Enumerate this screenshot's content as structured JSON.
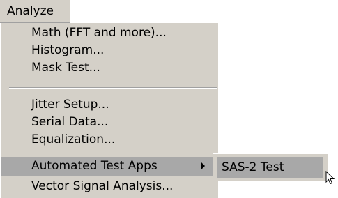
{
  "menubar": {
    "analyze_label": "Analyze"
  },
  "menu": {
    "items": [
      {
        "label": "Math (FFT and more)..."
      },
      {
        "label": "Histogram..."
      },
      {
        "label": "Mask Test..."
      },
      {
        "label": "Jitter Setup..."
      },
      {
        "label": "Serial Data..."
      },
      {
        "label": "Equalization..."
      },
      {
        "label": "Automated Test Apps"
      },
      {
        "label": "Vector Signal Analysis..."
      }
    ]
  },
  "submenu": {
    "items": [
      {
        "label": "SAS-2 Test"
      }
    ]
  },
  "icons": {
    "submenu_arrow": "chevron-right-icon",
    "pointer": "mouse-pointer-icon"
  },
  "colors": {
    "menu_background": "#d4d0c8",
    "highlight": "#a8a8a8",
    "text": "#000000"
  }
}
